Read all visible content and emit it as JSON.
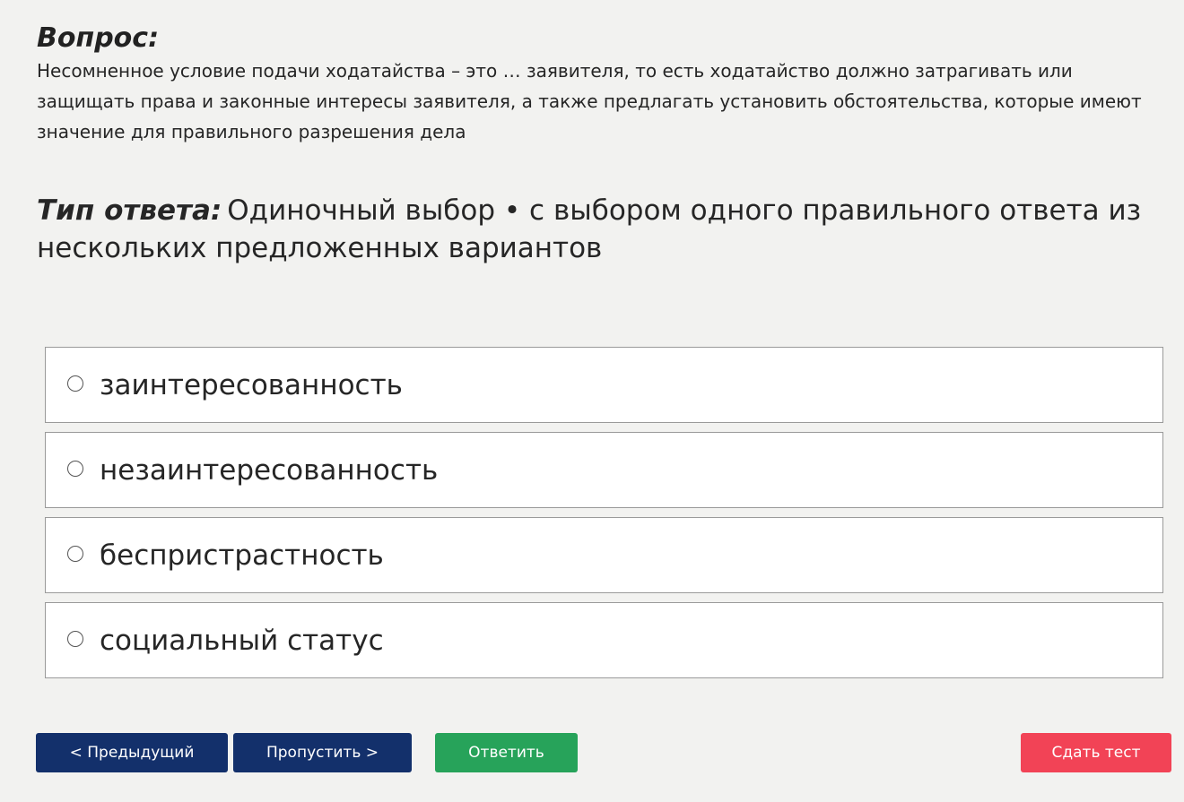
{
  "question": {
    "heading": "Вопрос:",
    "text": "Несомненное условие подачи ходатайства – это … заявителя, то есть ходатайство должно затрагивать или защищать права и законные интересы заявителя, а также предлагать установить обстоятельства, которые имеют значение для правильного разрешения дела"
  },
  "answer_type": {
    "label": "Тип ответа:",
    "value": "Одиночный выбор • с выбором одного правильного ответа из нескольких предложенных вариантов"
  },
  "options": [
    {
      "label": "заинтересованность",
      "selected": false
    },
    {
      "label": "незаинтересованность",
      "selected": false
    },
    {
      "label": "беспристрастность",
      "selected": false
    },
    {
      "label": "социальный статус",
      "selected": false
    }
  ],
  "buttons": {
    "prev": "< Предыдущий",
    "skip": "Пропустить >",
    "answer": "Ответить",
    "submit": "Сдать тест"
  },
  "colors": {
    "background": "#f2f2f0",
    "nav_button": "#13306b",
    "answer_button": "#27a35a",
    "submit_button": "#f24356"
  }
}
